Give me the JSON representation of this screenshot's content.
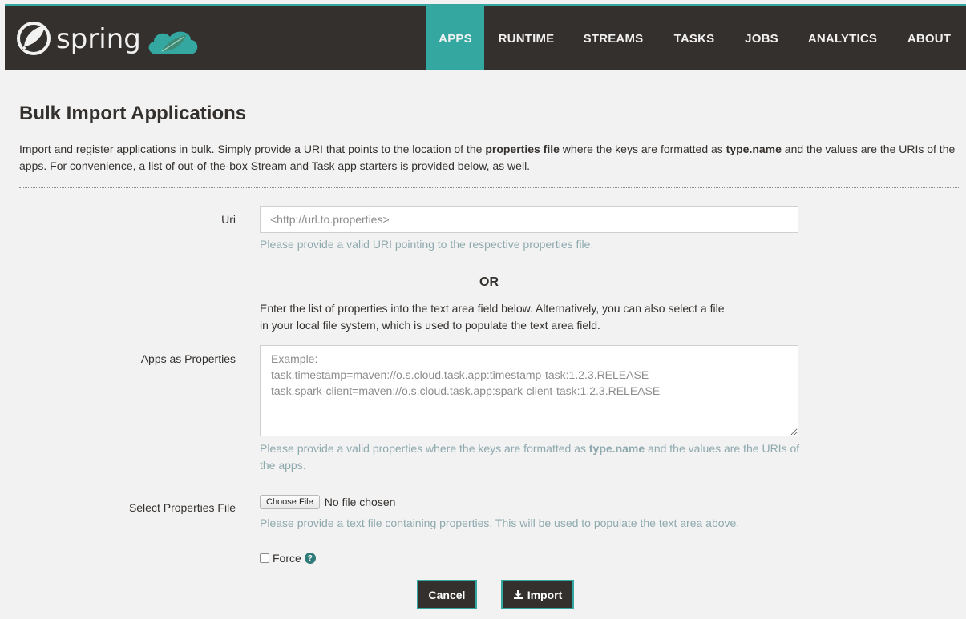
{
  "brand": {
    "name": "spring",
    "logo_icon": "spring-leaf-logo",
    "cloud_icon": "spring-cloud-leaf-icon"
  },
  "nav": {
    "items": [
      {
        "label": "APPS",
        "active": true
      },
      {
        "label": "RUNTIME",
        "active": false
      },
      {
        "label": "STREAMS",
        "active": false
      },
      {
        "label": "TASKS",
        "active": false
      },
      {
        "label": "JOBS",
        "active": false
      },
      {
        "label": "ANALYTICS",
        "active": false
      },
      {
        "label": "ABOUT",
        "active": false
      }
    ]
  },
  "page": {
    "title": "Bulk Import Applications",
    "intro_part1": "Import and register applications in bulk. Simply provide a URI that points to the location of the ",
    "intro_bold1": "properties file",
    "intro_part2": " where the keys are formatted as ",
    "intro_bold2": "type.name",
    "intro_part3": " and the values are the URIs of the apps. For convenience, a list of out-of-the-box Stream and Task app starters is provided below, as well."
  },
  "form": {
    "uri_label": "Uri",
    "uri_placeholder": "<http://url.to.properties>",
    "uri_help": "Please provide a valid URI pointing to the respective properties file.",
    "or_text": "OR",
    "instructions": "Enter the list of properties into the text area field below. Alternatively, you can also select a file in your local file system, which is used to populate the text area field.",
    "apps_label": "Apps as Properties",
    "apps_placeholder": "Example:\ntask.timestamp=maven://o.s.cloud.task.app:timestamp-task:1.2.3.RELEASE\ntask.spark-client=maven://o.s.cloud.task.app:spark-client-task:1.2.3.RELEASE",
    "apps_help_part1": "Please provide a valid properties where the keys are formatted as ",
    "apps_help_bold": "type.name",
    "apps_help_part2": " and the values are the URIs of the apps.",
    "file_label": "Select Properties File",
    "file_button": "Choose File",
    "file_status": "No file chosen",
    "file_help": "Please provide a text file containing properties. This will be used to populate the text area above.",
    "force_label": "Force",
    "force_help_icon": "question-circle-icon",
    "force_checked": false
  },
  "actions": {
    "cancel_label": "Cancel",
    "import_label": "Import",
    "import_icon": "import-icon"
  },
  "colors": {
    "navbar_bg": "#34302d",
    "accent": "#34a7a0",
    "page_bg": "#f2f2f2",
    "help_text": "#8ea9ae"
  }
}
